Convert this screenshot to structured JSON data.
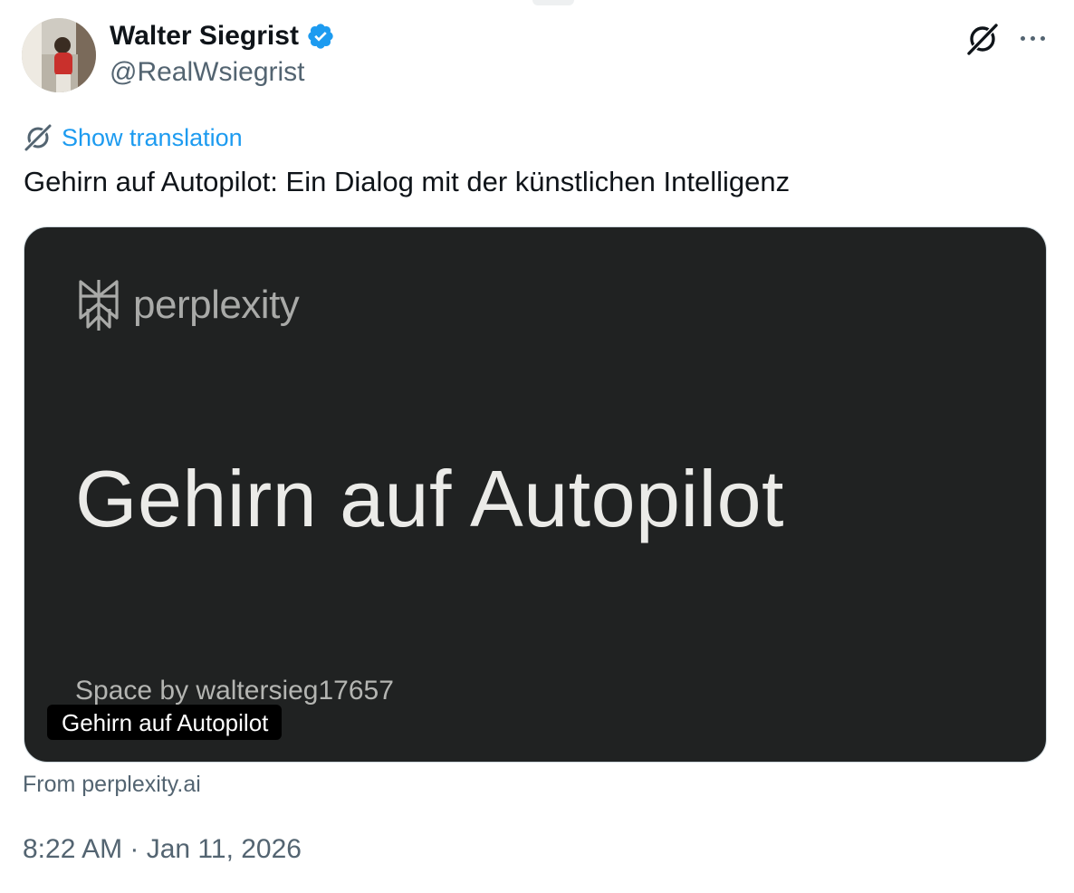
{
  "author": {
    "name": "Walter Siegrist",
    "handle": "@RealWsiegrist",
    "verified": true,
    "avatar_icon": "profile-photo"
  },
  "actions": {
    "grok_icon": "grok-icon",
    "more_icon": "more-dots-icon"
  },
  "translation": {
    "icon": "grok-icon",
    "link_label": "Show translation"
  },
  "tweet": {
    "text": "Gehirn auf Autopilot: Ein Dialog mit der künstlichen Intelligenz",
    "timestamp": "8:22 AM · Jan 11, 2026"
  },
  "card": {
    "logo_word": "perplexity",
    "logo_icon": "perplexity-logo-icon",
    "heading": "Gehirn auf Autopilot",
    "space_by": "Space by waltersieg17657",
    "caption": "Gehirn auf Autopilot",
    "source": "From perplexity.ai"
  },
  "colors": {
    "link": "#1d9bf0",
    "verified_badge": "#1d9bf0",
    "card_bg": "#202222",
    "muted_text": "#536471"
  }
}
